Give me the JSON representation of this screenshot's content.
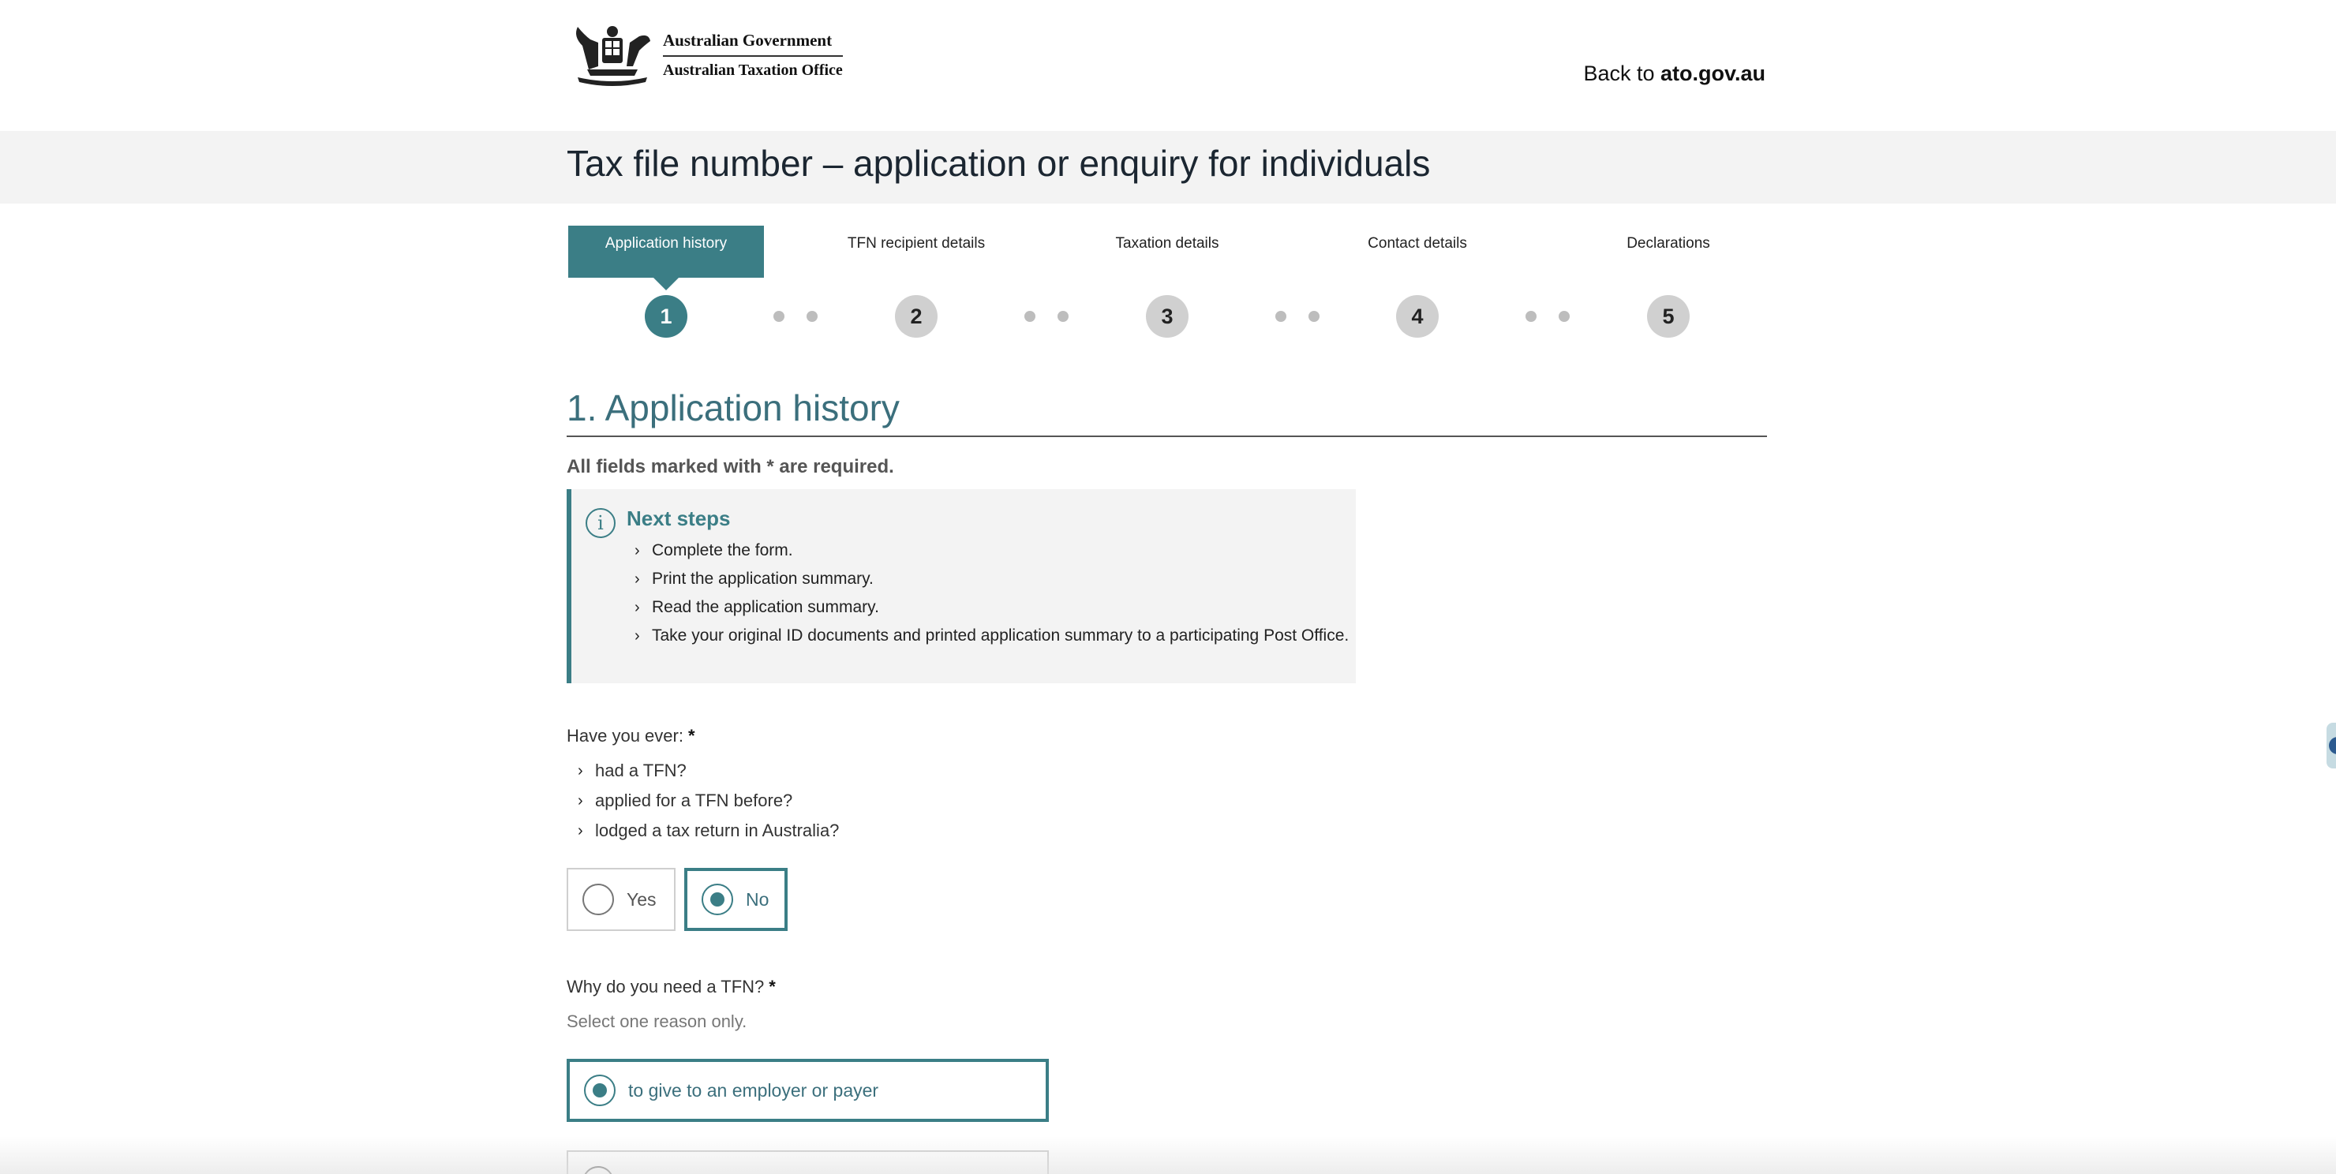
{
  "header": {
    "logo_line1": "Australian Government",
    "logo_line2": "Australian Taxation Office",
    "back_prefix": "Back to ",
    "back_link": "ato.gov.au"
  },
  "page_title": "Tax file number – application or enquiry for individuals",
  "stepper": {
    "current_step": 1,
    "steps": [
      {
        "number": "1",
        "label": "Application history"
      },
      {
        "number": "2",
        "label": "TFN recipient details"
      },
      {
        "number": "3",
        "label": "Taxation details"
      },
      {
        "number": "4",
        "label": "Contact details"
      },
      {
        "number": "5",
        "label": "Declarations"
      }
    ]
  },
  "section": {
    "heading": "1. Application history",
    "required_note_prefix": "All fields marked with ",
    "required_star": "*",
    "required_note_suffix": " are required."
  },
  "next_steps": {
    "icon": "info-icon",
    "icon_glyph": "i",
    "title": "Next steps",
    "items": [
      "Complete the form.",
      "Print the application summary.",
      "Read the application summary.",
      "Take your original ID documents and printed application summary to a participating Post Office."
    ]
  },
  "question1": {
    "label": "Have you ever:",
    "star": "*",
    "items": [
      "had a TFN?",
      "applied for a TFN before?",
      "lodged a tax return in Australia?"
    ],
    "options": [
      {
        "label": "Yes",
        "selected": false
      },
      {
        "label": "No",
        "selected": true
      }
    ]
  },
  "question2": {
    "label": "Why do you need a TFN?",
    "star": "*",
    "hint": "Select one reason only.",
    "options": [
      {
        "label": "to give to an employer or payer",
        "selected": true
      }
    ]
  },
  "colors": {
    "accent": "#3b7e86",
    "heading": "#3b6f7c",
    "title_band": "#f3f3f3",
    "info_box": "#f3f3f3",
    "inactive_step": "#d0d0d0"
  }
}
